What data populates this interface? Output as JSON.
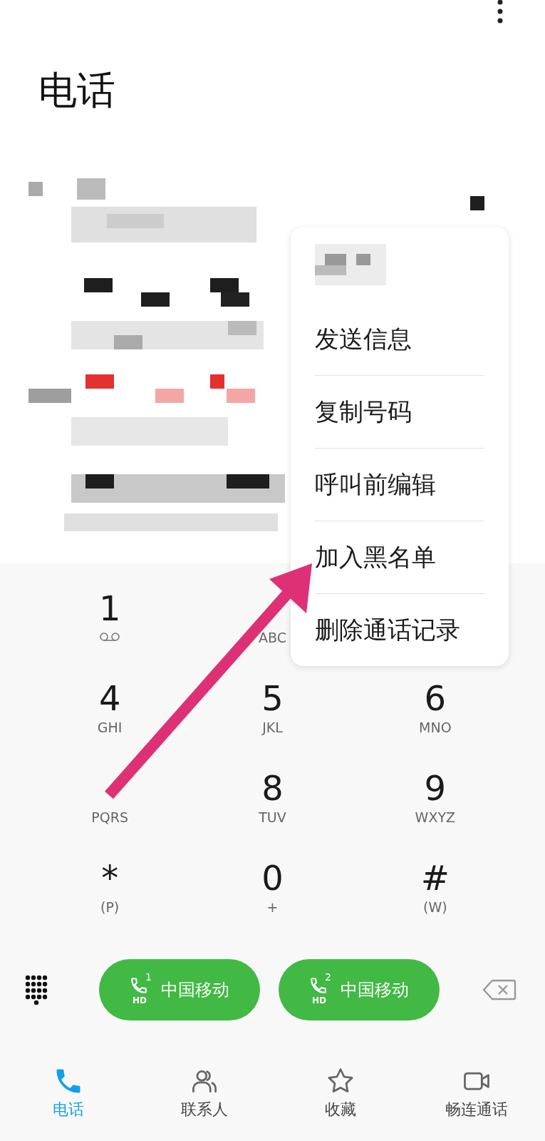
{
  "header": {
    "title": "电话"
  },
  "context_menu": {
    "items": [
      {
        "label": "发送信息"
      },
      {
        "label": "复制号码"
      },
      {
        "label": "呼叫前编辑"
      },
      {
        "label": "加入黑名单"
      },
      {
        "label": "删除通话记录"
      }
    ]
  },
  "keypad": {
    "rows": [
      [
        {
          "digit": "1",
          "kind": "voicemail"
        },
        {
          "letters": "ABC",
          "kind": "letters"
        }
      ],
      [
        {
          "digit": "4",
          "letters": "GHI",
          "kind": "letters"
        },
        {
          "digit": "5",
          "letters": "JKL",
          "kind": "letters"
        },
        {
          "digit": "6",
          "letters": "MNO",
          "kind": "letters"
        }
      ],
      [
        {
          "letters": "PQRS",
          "kind": "letters"
        },
        {
          "digit": "8",
          "letters": "TUV",
          "kind": "letters"
        },
        {
          "digit": "9",
          "letters": "WXYZ",
          "kind": "letters"
        }
      ],
      [
        {
          "digit": "*",
          "letters": "(P)",
          "kind": "letters"
        },
        {
          "digit": "0",
          "letters": "+",
          "kind": "letters"
        },
        {
          "digit": "#",
          "letters": "(W)",
          "kind": "letters"
        }
      ]
    ]
  },
  "call_buttons": [
    {
      "sim": "1",
      "badge": "HD",
      "label": "中国移动"
    },
    {
      "sim": "2",
      "badge": "HD",
      "label": "中国移动"
    }
  ],
  "bottom_nav": [
    {
      "label": "电话",
      "kind": "phone",
      "selected": true
    },
    {
      "label": "联系人",
      "kind": "contacts",
      "selected": false
    },
    {
      "label": "收藏",
      "kind": "star",
      "selected": false
    },
    {
      "label": "畅连通话",
      "kind": "video",
      "selected": false
    }
  ]
}
